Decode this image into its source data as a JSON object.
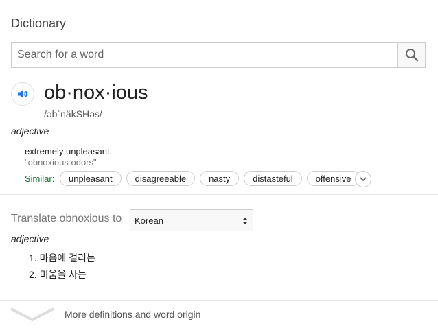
{
  "header": {
    "title": "Dictionary"
  },
  "search": {
    "placeholder": "Search for a word",
    "value": ""
  },
  "entry": {
    "word": "ob·nox·ious",
    "pronunciation": "/əbˈnäkSHəs/",
    "part_of_speech": "adjective",
    "definition": "extremely unpleasant.",
    "example": "\"obnoxious odors\"",
    "similar_label": "Similar:",
    "similar": [
      "unpleasant",
      "disagreeable",
      "nasty",
      "distasteful",
      "offensive"
    ]
  },
  "translate": {
    "label": "Translate obnoxious to",
    "language": "Korean",
    "part_of_speech": "adjective",
    "items": [
      "1. 마음에 걸리는",
      "2. 미움을 사는"
    ]
  },
  "footer": {
    "more_label": "More definitions and word origin"
  },
  "colors": {
    "accent_blue": "#1a73e8",
    "similar_green": "#137333"
  },
  "icons": [
    "search-icon",
    "speaker-icon",
    "chevron-down-icon",
    "select-arrows-icon"
  ]
}
